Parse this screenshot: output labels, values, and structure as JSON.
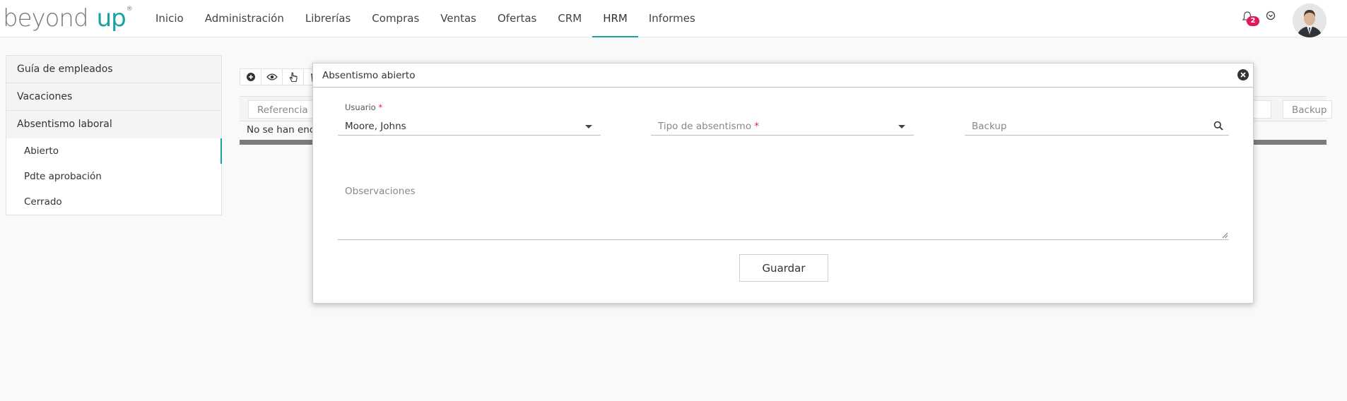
{
  "brand": {
    "beyond": "beyond",
    "up": "up",
    "reg": "®"
  },
  "nav": {
    "items": [
      {
        "label": "Inicio"
      },
      {
        "label": "Administración"
      },
      {
        "label": "Librerías"
      },
      {
        "label": "Compras"
      },
      {
        "label": "Ventas"
      },
      {
        "label": "Ofertas"
      },
      {
        "label": "CRM"
      },
      {
        "label": "HRM",
        "active": true
      },
      {
        "label": "Informes"
      }
    ],
    "notifications_count": "2",
    "accent_color": "#18a3a0",
    "badge_color": "#e0195a"
  },
  "sidebar": {
    "items": [
      {
        "label": "Guía de empleados"
      },
      {
        "label": "Vacaciones"
      },
      {
        "label": "Absentismo laboral"
      }
    ],
    "subitems": [
      {
        "label": "Abierto",
        "active": true
      },
      {
        "label": "Pdte aprobación"
      },
      {
        "label": "Cerrado"
      }
    ]
  },
  "toolbar": {
    "icons": [
      "add-icon",
      "view-icon",
      "hand-pointer-icon",
      "trash-icon"
    ]
  },
  "grid": {
    "columns": {
      "reference": "Referencia",
      "backup": "Backup"
    },
    "empty_text": "No se han enco"
  },
  "modal": {
    "title": "Absentismo abierto",
    "usuario_label": "Usuario",
    "required_mark": "*",
    "usuario_value": "Moore, Johns",
    "tipo_placeholder": "Tipo de absentismo",
    "backup_placeholder": "Backup",
    "observaciones_placeholder": "Observaciones",
    "save_label": "Guardar"
  }
}
